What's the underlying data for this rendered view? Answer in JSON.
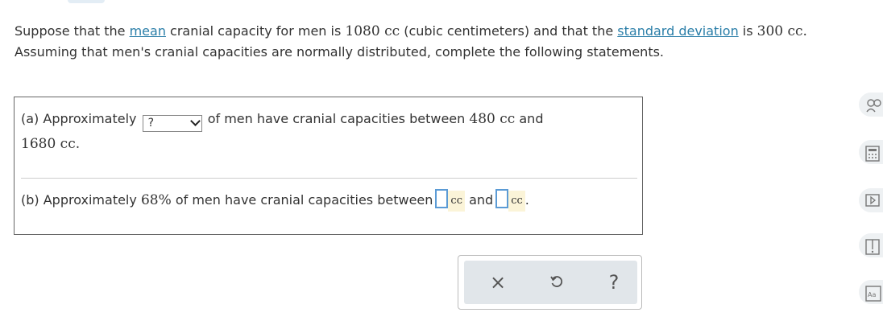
{
  "prompt": {
    "p1": "Suppose that the ",
    "mean_link": "mean",
    "p2": " cranial capacity for men is ",
    "mean_value": "1080 cc",
    "p3": " (cubic centimeters) and that the ",
    "sd_link": "standard deviation",
    "p4": " is ",
    "sd_value": "300 cc.",
    "line2": "Assuming that men's cranial capacities are normally distributed, complete the following statements."
  },
  "part_a": {
    "prefix": "(a) Approximately",
    "select_value": "?",
    "middle": "of men have cranial capacities between",
    "low": "480 cc",
    "and": "and",
    "high": "1680 cc."
  },
  "part_b": {
    "prefix": "(b) Approximately",
    "percent": "68%",
    "middle": "of men have cranial capacities between",
    "unit1": "cc",
    "and": "and",
    "unit2": "cc",
    "period": "."
  },
  "toolbar": {
    "clear_icon": "×",
    "undo_icon": "undo-icon",
    "help_icon": "?"
  },
  "sidebar": [
    "person-help-icon",
    "calculator-icon",
    "video-icon",
    "book-icon",
    "text-size-icon"
  ],
  "colors": {
    "link": "#2a7ea8",
    "answer_border": "#5b9bd5",
    "unit_bg": "#fbf4d8",
    "toolbar_bg": "#e1e6ea"
  }
}
